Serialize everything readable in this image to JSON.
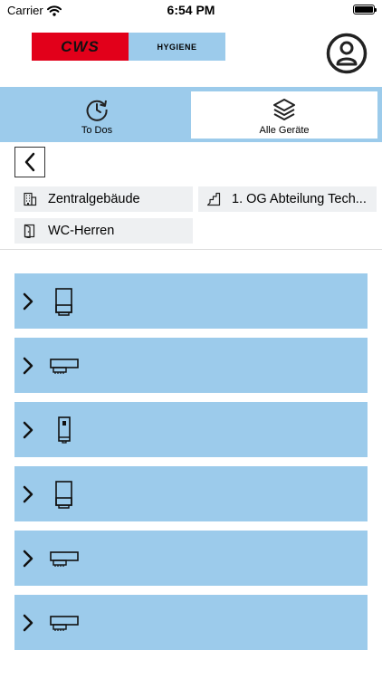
{
  "status_bar": {
    "carrier": "Carrier",
    "time": "6:54 PM"
  },
  "header": {
    "logo": {
      "brand": "CWS",
      "tagline": "HYGIENE",
      "brand_color": "#e2001a",
      "tagline_bg": "#9ccbeb"
    },
    "profile_icon": "user-circle-icon"
  },
  "tabs": [
    {
      "label": "To Dos",
      "icon": "history-clock-icon",
      "active": false
    },
    {
      "label": "Alle Geräte",
      "icon": "layers-icon",
      "active": true
    }
  ],
  "location": {
    "building": "Zentralgebäude",
    "floor": "1. OG Abteilung Tech...",
    "room": "WC-Herren"
  },
  "devices": [
    {
      "icon": "towel-dispenser-icon"
    },
    {
      "icon": "soap-dispenser-wide-icon"
    },
    {
      "icon": "small-dispenser-icon"
    },
    {
      "icon": "towel-dispenser-icon"
    },
    {
      "icon": "soap-dispenser-wide-icon"
    },
    {
      "icon": "soap-dispenser-wide-icon"
    }
  ],
  "colors": {
    "accent": "#9ccbeb",
    "chip_bg": "#eef0f2"
  }
}
